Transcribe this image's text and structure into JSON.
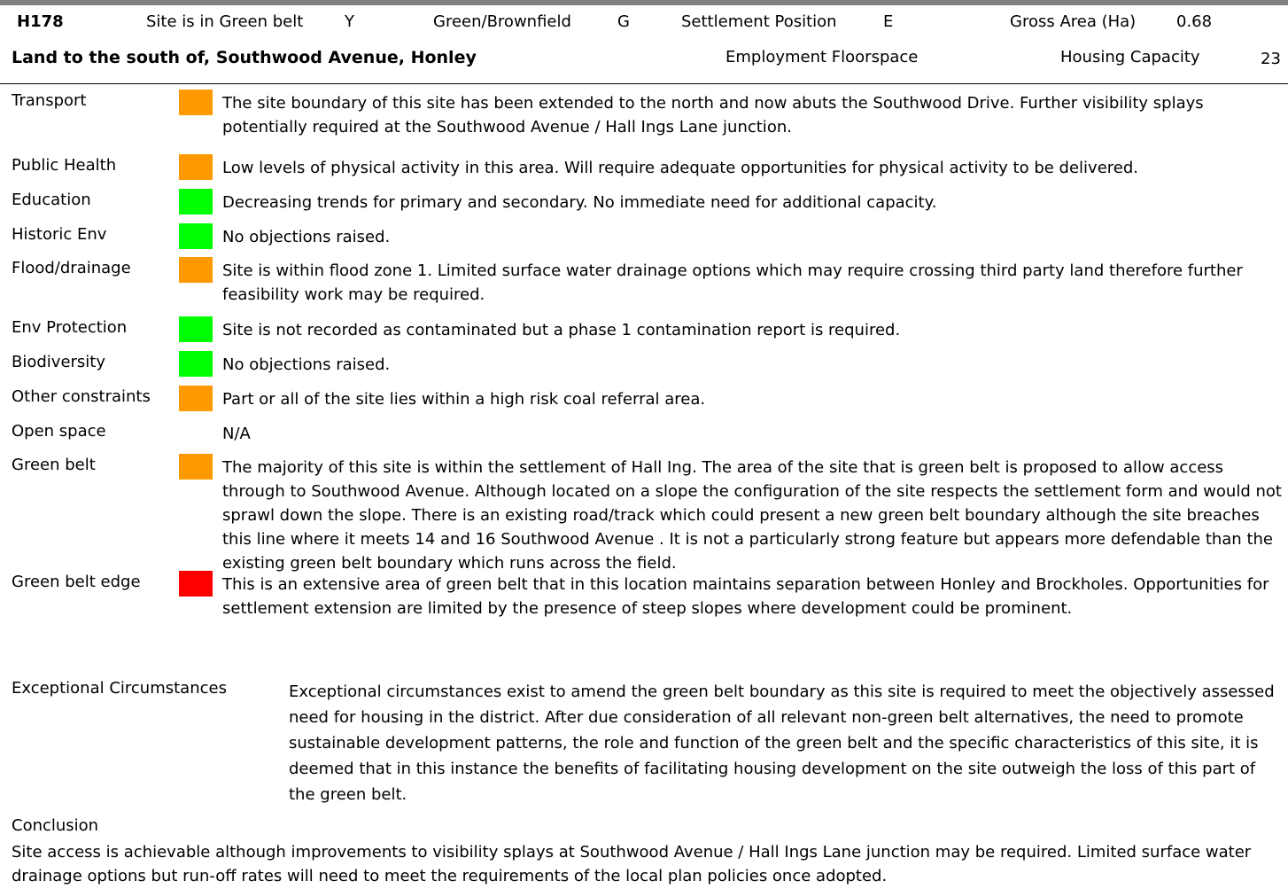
{
  "header": {
    "site_ref": "H178",
    "green_belt_label": "Site is in Green belt",
    "green_belt_value": "Y",
    "gb_label": "Green/Brownfield",
    "gb_value": "G",
    "settlement_label": "Settlement Position",
    "settlement_value": "E",
    "gross_area_label": "Gross Area (Ha)",
    "gross_area_value": "0.68",
    "site_name": "Land to the south of, Southwood Avenue, Honley",
    "employment_label": "Employment Floorspace",
    "housing_label": "Housing Capacity",
    "housing_value": "23"
  },
  "colors": {
    "amber": "#FF9900",
    "green": "#00FF00",
    "red": "#FF0000",
    "rule": "#808080"
  },
  "rows": [
    {
      "label": "Transport",
      "rating": "amber",
      "text": "The site boundary of this site has been extended to the north and now abuts the Southwood Drive. Further visibility splays potentially required at the Southwood Avenue / Hall Ings Lane junction."
    },
    {
      "label": "Public Health",
      "rating": "amber",
      "text": "Low levels of physical activity in this area. Will require adequate opportunities for physical activity to be delivered."
    },
    {
      "label": "Education",
      "rating": "green",
      "text": "Decreasing trends for primary and secondary. No immediate need for additional capacity."
    },
    {
      "label": "Historic Env",
      "rating": "green",
      "text": "No objections raised."
    },
    {
      "label": "Flood/drainage",
      "rating": "amber",
      "text": "Site is within flood zone 1. Limited surface water drainage options which may require crossing third party land therefore further feasibility work may be required."
    },
    {
      "label": "Env Protection",
      "rating": "green",
      "text": "Site is not recorded as contaminated but a phase 1 contamination report is required."
    },
    {
      "label": "Biodiversity",
      "rating": "green",
      "text": "No objections raised."
    },
    {
      "label": "Other constraints",
      "rating": "amber",
      "text": "Part or all of the site lies within a high risk coal referral area."
    },
    {
      "label": "Open space",
      "rating": "",
      "text": "N/A"
    },
    {
      "label": "Green belt",
      "rating": "amber",
      "text": "The majority of this site is within the settlement of Hall Ing. The area of the site that is green belt is proposed to allow access through to Southwood Avenue. Although located on a slope the configuration of the site respects the settlement form and would not sprawl down the slope. There is an existing road/track which could present a new green belt boundary although the site breaches this line where it meets 14 and 16 Southwood Avenue . It is not a particularly strong feature but appears more defendable than the existing green belt boundary which runs across the field."
    },
    {
      "label": "Green belt edge",
      "rating": "red",
      "text": "This is an extensive area of green belt that in this location maintains separation between Honley and Brockholes. Opportunities for settlement extension are limited by the presence of steep slopes where development could be prominent."
    }
  ],
  "exceptional": {
    "label": "Exceptional Circumstances",
    "text": "Exceptional circumstances exist to amend the green belt boundary as this site is required to meet the objectively assessed need for housing in the district. After due consideration of all relevant non-green belt alternatives, the need to promote sustainable development patterns, the role and function of the green belt and the specific characteristics of this site, it is deemed that in this instance the benefits of facilitating housing development on the site outweigh the loss of this part of the green belt."
  },
  "conclusion": {
    "label": "Conclusion",
    "text": "Site access is achievable although improvements to visibility splays at Southwood Avenue / Hall Ings Lane junction may be required. Limited surface water drainage options but run-off rates will need to meet the requirements of the local plan policies once adopted."
  }
}
